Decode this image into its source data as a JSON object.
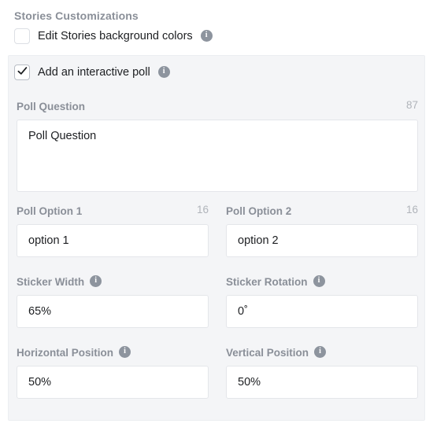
{
  "section": {
    "title": "Stories Customizations"
  },
  "checkboxes": [
    {
      "name": "edit-stories-background-colors",
      "label": "Edit Stories background colors",
      "checked": false,
      "has_info": true
    },
    {
      "name": "add-an-interactive-poll",
      "label": "Add an interactive poll",
      "checked": true,
      "has_info": true
    }
  ],
  "icons": {
    "info": "info-icon",
    "check": "check-icon"
  },
  "colors": {
    "panel_background": "#f4f5f7",
    "page_background": "#ffffff",
    "label_gray": "#8a8f98",
    "counter_gray": "#b0b4ba",
    "input_border": "#e4e6ea",
    "info_icon": "#8d949e",
    "text": "#1c1e21"
  },
  "fields": {
    "poll_question": {
      "label": "Poll Question",
      "counter": "87",
      "value": "Poll Question",
      "placeholder": "Poll Question",
      "has_info": false
    },
    "poll_option_1": {
      "label": "Poll Option 1",
      "counter": "16",
      "value": "option 1",
      "placeholder": "option 1",
      "has_info": false
    },
    "poll_option_2": {
      "label": "Poll Option 2",
      "counter": "16",
      "value": "option 2",
      "placeholder": "option 2",
      "has_info": false
    },
    "sticker_width": {
      "label": "Sticker Width",
      "counter": "",
      "value": "65%",
      "placeholder": "65%",
      "has_info": true
    },
    "sticker_rotation": {
      "label": "Sticker Rotation",
      "counter": "",
      "value": "0˚",
      "placeholder": "0˚",
      "has_info": true
    },
    "horizontal_position": {
      "label": "Horizontal Position",
      "counter": "",
      "value": "50%",
      "placeholder": "50%",
      "has_info": true
    },
    "vertical_position": {
      "label": "Vertical Position",
      "counter": "",
      "value": "50%",
      "placeholder": "50%",
      "has_info": true
    }
  }
}
